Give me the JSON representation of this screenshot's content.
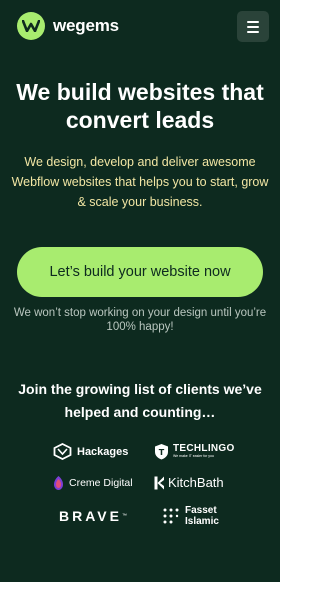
{
  "header": {
    "brand": "wegems",
    "menu_icon": "hamburger-icon"
  },
  "hero": {
    "title": "We build websites that convert leads",
    "subtitle": "We design, develop and deliver awesome Webflow websites that helps you to start, grow & scale your business.",
    "cta_label": "Let’s build your website now",
    "cta_note": "We won’t stop working on your design until you’re 100% happy!"
  },
  "clients": {
    "title": "Join the growing list of clients we’ve helped and counting…",
    "logos": {
      "hackages": "Hackages",
      "techlingo": "TECHLINGO",
      "techlingo_tag": "We make IT easier for you",
      "creme_digital": "Creme Digital",
      "kitchbath": "KitchBath",
      "brave": "BRAVE",
      "fasset_line1": "Fasset",
      "fasset_line2": "Islamic"
    }
  },
  "colors": {
    "background": "#0d2a1f",
    "accent": "#a8ec6f",
    "subtitle": "#f2e6a4",
    "menu_button": "#2a4339"
  }
}
